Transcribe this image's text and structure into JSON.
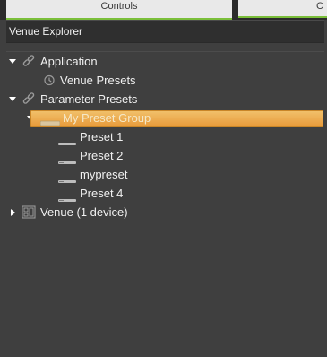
{
  "tabs": {
    "controls": "Controls",
    "second": "C"
  },
  "panel": {
    "title": "Venue Explorer"
  },
  "tree": {
    "application": {
      "label": "Application",
      "expanded": true,
      "icon": "link-icon"
    },
    "venue_presets": {
      "label": "Venue Presets",
      "icon": "clock-icon"
    },
    "parameter_presets": {
      "label": "Parameter Presets",
      "expanded": true,
      "icon": "link-icon"
    },
    "preset_group": {
      "label": "My Preset Group",
      "expanded": true,
      "selected": true,
      "icon": "preset-group-icon"
    },
    "presets": [
      {
        "label": "Preset 1",
        "icon": "preset-icon"
      },
      {
        "label": "Preset 2",
        "icon": "preset-icon"
      },
      {
        "label": "mypreset",
        "icon": "preset-icon"
      },
      {
        "label": "Preset 4",
        "icon": "preset-icon"
      }
    ],
    "venue": {
      "label": "Venue (1 device)",
      "expanded": false,
      "icon": "venue-icon"
    }
  },
  "colors": {
    "accent_tab": "#7bbf3a",
    "selection": "#e89a3a",
    "background": "#3f3f3f"
  }
}
